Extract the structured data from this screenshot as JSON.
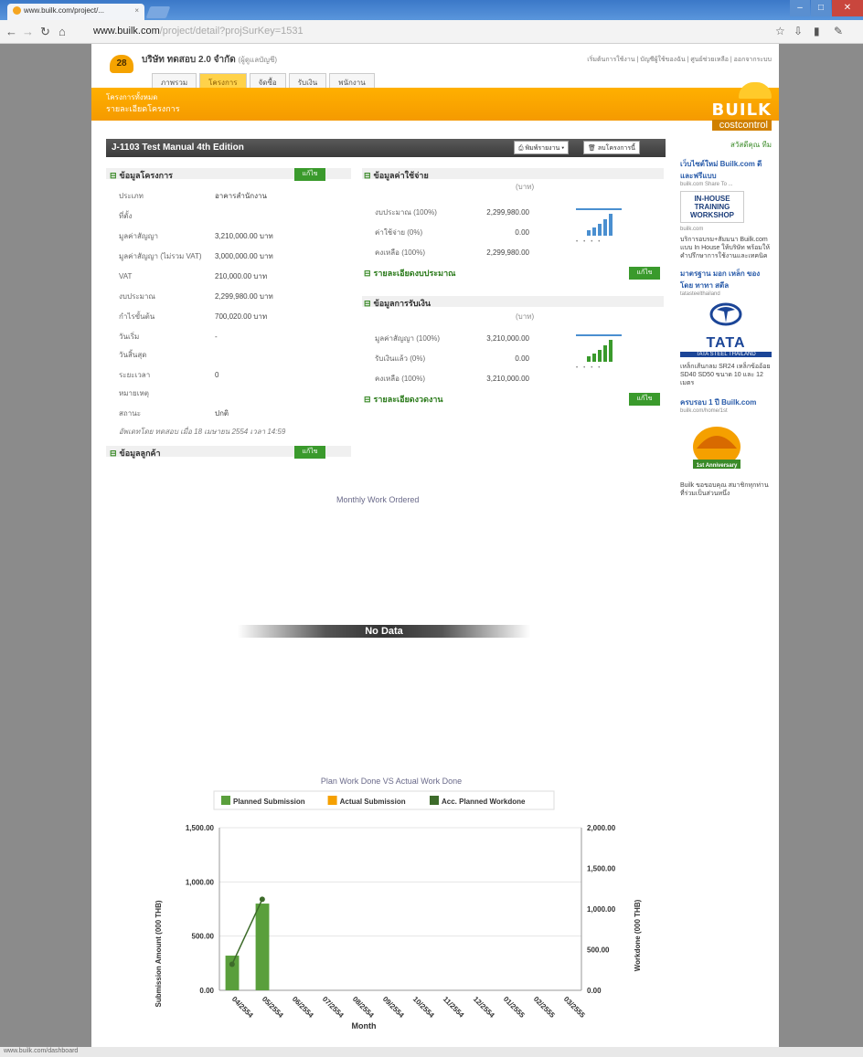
{
  "browser": {
    "tab_title": "www.builk.com/project/...",
    "url_host": "www.builk.com",
    "url_path": "/project/detail?projSurKey=1531"
  },
  "header": {
    "logo_text": "28",
    "company": "บริษัท ทดสอบ 2.0 จำกัด",
    "company_sub": "(ผู้ดูแลบัญชี)",
    "top_links": "เริ่มต้นการใช้งาน | บัญชีผู้ใช้ของฉัน | ศูนย์ช่วยเหลือ | ออกจากระบบ",
    "tabs": [
      "ภาพรวม",
      "โครงการ",
      "จัดซื้อ",
      "รับเงิน",
      "พนักงาน"
    ],
    "breadcrumb": "โครงการทั้งหมด",
    "breadcrumb_sub": "รายละเอียดโครงการ",
    "brand_top": "BUILK",
    "brand_bottom": "costcontrol"
  },
  "project": {
    "title": "J-1103 Test Manual 4th Edition",
    "print_button": "พิมพ์รายงาน",
    "delete_button": "ลบโครงการนี้"
  },
  "info": {
    "heading": "ข้อมูลโครงการ",
    "edit": "แก้ไข",
    "rows": [
      {
        "label": "ประเภท",
        "value": "อาคารสำนักงาน"
      },
      {
        "label": "ที่ตั้ง",
        "value": ""
      },
      {
        "label": "มูลค่าสัญญา",
        "value": "3,210,000.00 บาท"
      },
      {
        "label": "มูลค่าสัญญา (ไม่รวม VAT)",
        "value": "3,000,000.00 บาท"
      },
      {
        "label": "VAT",
        "value": "210,000.00 บาท"
      },
      {
        "label": "งบประมาณ",
        "value": "2,299,980.00 บาท"
      },
      {
        "label": "กำไรขั้นต้น",
        "value": "700,020.00 บาท"
      },
      {
        "label": "วันเริ่ม",
        "value": "-"
      },
      {
        "label": "วันสิ้นสุด",
        "value": ""
      },
      {
        "label": "ระยะเวลา",
        "value": "0"
      },
      {
        "label": "หมายเหตุ",
        "value": ""
      },
      {
        "label": "สถานะ",
        "value": "ปกติ"
      }
    ],
    "updated": "อัพเดทโดย ทดสอบ เมื่อ 18 เมษายน 2554 เวลา 14:59"
  },
  "customer": {
    "heading": "ข้อมูลลูกค้า",
    "edit": "แก้ไข"
  },
  "expense": {
    "heading": "ข้อมูลค่าใช้จ่าย",
    "unit": "(บาท)",
    "rows": [
      {
        "label": "งบประมาณ (100%)",
        "value": "2,299,980.00"
      },
      {
        "label": "ค่าใช้จ่าย (0%)",
        "value": "0.00"
      },
      {
        "label": "คงเหลือ (100%)",
        "value": "2,299,980.00"
      }
    ],
    "sub_heading": "รายละเอียดงบประมาณ",
    "edit": "แก้ไข"
  },
  "finance": {
    "heading": "ข้อมูลการรับเงิน",
    "unit": "(บาท)",
    "rows": [
      {
        "label": "มูลค่าสัญญา (100%)",
        "value": "3,210,000.00"
      },
      {
        "label": "รับเงินแล้ว (0%)",
        "value": "0.00"
      },
      {
        "label": "คงเหลือ (100%)",
        "value": "3,210,000.00"
      }
    ],
    "sub_heading": "รายละเอียดงวดงาน",
    "edit": "แก้ไข"
  },
  "sidebar": {
    "head": "สวัสดีคุณ ทีม",
    "item1_title": "เว็บไซต์ใหม่ Builk.com ดี และฟรีแบบ",
    "item1_small": "builk.com Share To ...",
    "ad1_lines": [
      "IN-HOUSE",
      "TRAINING",
      "WORKSHOP"
    ],
    "ad1_small": "builk.com",
    "item2_text": "บริการอบรม+สัมมนา Builk.com แบบ In House ให้บริษัท พร้อมให้คำปรึกษาการใช้งานและเทคนิค",
    "item3_title": "มาตรฐาน มอก เหล็ก ของ โดย ทาทา สตีล",
    "item3_small": "tatasteelthailand",
    "tata": "TATA",
    "tata_sub": "TATA STEEL THAILAND",
    "item4_text": "เหล็กเส้นกลม SR24 เหล็กข้ออ้อย SD40 SD50 ขนาด 10 และ 12 เมตร",
    "item5_title": "ครบรอบ 1 ปี Builk.com",
    "item5_small": "builk.com/home/1st",
    "anniv_label": "1st Anniversary",
    "item6_text": "Builk ขอขอบคุณ สมาชิกทุกท่านที่ร่วมเป็นส่วนหนึ่ง"
  },
  "monthly": {
    "title": "Monthly Work Ordered",
    "no_data": "No Data"
  },
  "chart_data": {
    "type": "bar",
    "title": "Plan Work Done VS Actual Work Done",
    "categories": [
      "04/2554",
      "05/2554",
      "06/2554",
      "07/2554",
      "08/2554",
      "09/2554",
      "10/2554",
      "11/2554",
      "12/2554",
      "01/2555",
      "02/2555",
      "03/2555"
    ],
    "series": [
      {
        "name": "Planned Submission",
        "kind": "bar",
        "axis": "left",
        "color": "#5a9f3c",
        "values": [
          320,
          800,
          0,
          0,
          0,
          0,
          0,
          0,
          0,
          0,
          0,
          0
        ]
      },
      {
        "name": "Actual Submission",
        "kind": "bar",
        "axis": "left",
        "color": "#f5a000",
        "values": [
          0,
          0,
          0,
          0,
          0,
          0,
          0,
          0,
          0,
          0,
          0,
          0
        ]
      },
      {
        "name": "Acc. Planned Workdone",
        "kind": "line",
        "axis": "right",
        "color": "#3d6b2a",
        "values": [
          320,
          1120,
          null,
          null,
          null,
          null,
          null,
          null,
          null,
          null,
          null,
          null
        ]
      }
    ],
    "xlabel": "Month",
    "ylabel": "Submission Amount (000 THB)",
    "y2label": "Workdone (000 THB)",
    "ylim": [
      0,
      1500
    ],
    "y2lim": [
      0,
      2000
    ],
    "yticks": [
      "0.00",
      "500.00",
      "1,000.00",
      "1,500.00"
    ],
    "y2ticks": [
      "0.00",
      "500.00",
      "1,000.00",
      "1,500.00",
      "2,000.00"
    ],
    "legend": "top",
    "grid": true
  },
  "status_bar": "www.builk.com/dashboard"
}
